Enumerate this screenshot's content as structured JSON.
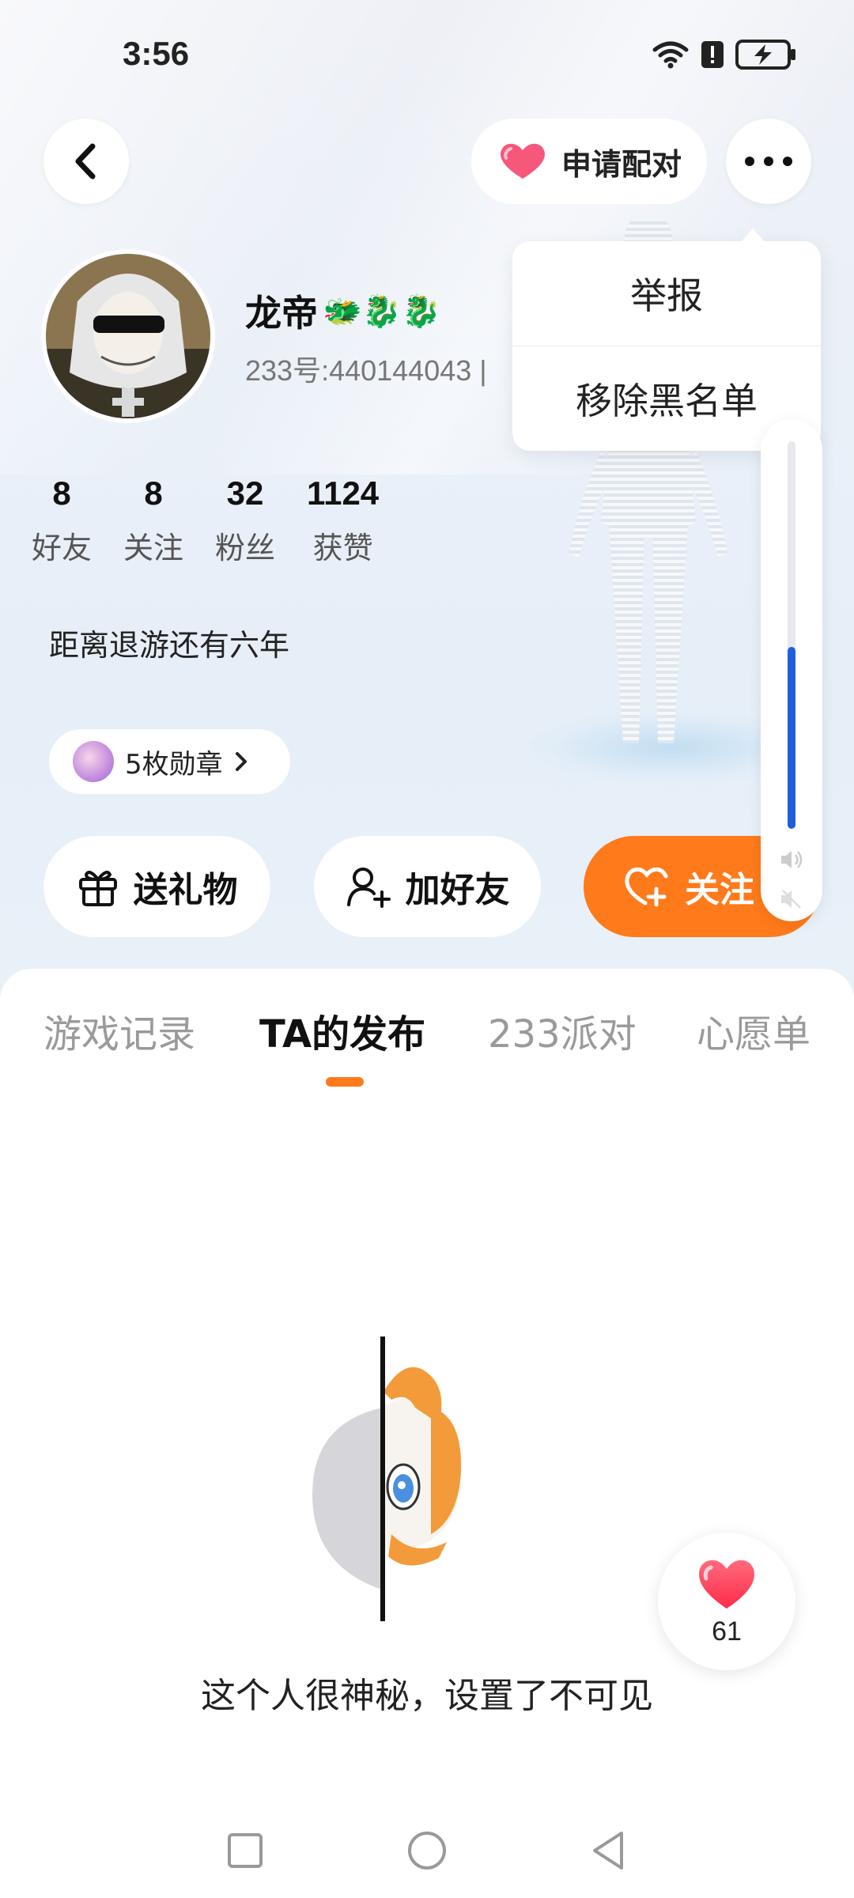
{
  "status_bar": {
    "time": "3:56"
  },
  "top_bar": {
    "pair_label": "申请配对"
  },
  "dropdown": {
    "items": [
      "举报",
      "移除黑名单"
    ]
  },
  "volume": {
    "level": 0.47
  },
  "profile": {
    "name": "龙帝",
    "name_emoji": "🐲🐉🐉",
    "uid": "233号:440144043 |",
    "stats": [
      {
        "value": "8",
        "label": "好友"
      },
      {
        "value": "8",
        "label": "关注"
      },
      {
        "value": "32",
        "label": "粉丝"
      },
      {
        "value": "1124",
        "label": "获赞"
      }
    ],
    "bio": "距离退游还有六年",
    "badges_label": "5枚勋章"
  },
  "actions": {
    "gift": "送礼物",
    "add_friend": "加好友",
    "follow": "关注"
  },
  "tabs": [
    "游戏记录",
    "TA的发布",
    "233派对",
    "心愿单"
  ],
  "active_tab": 1,
  "empty_state": {
    "message": "这个人很神秘，设置了不可见"
  },
  "like_fab": {
    "count": "61"
  },
  "colors": {
    "accent": "#ff7a1a",
    "volume": "#1f5fdc"
  }
}
